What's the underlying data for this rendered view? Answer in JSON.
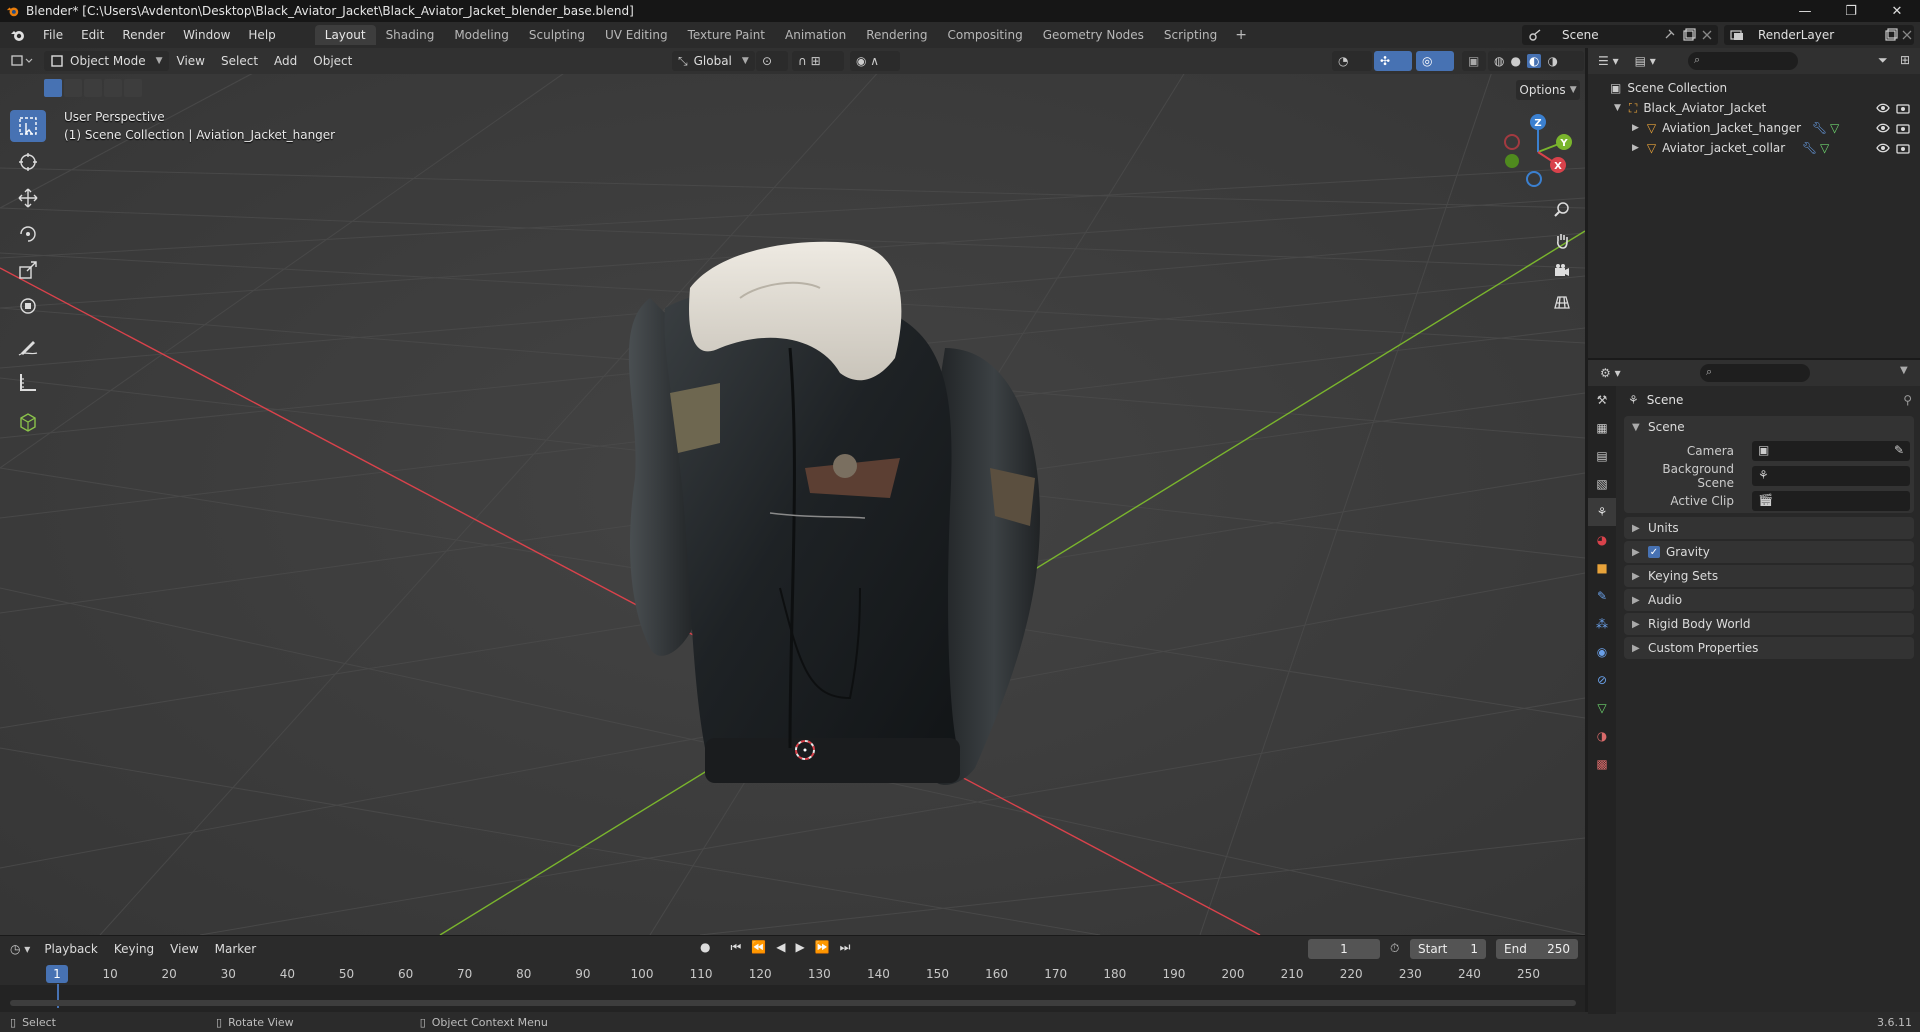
{
  "window": {
    "title": "Blender* [C:\\Users\\Avdenton\\Desktop\\Black_Aviator_Jacket\\Black_Aviator_Jacket_blender_base.blend]",
    "minimize": "—",
    "maximize": "❐",
    "close": "✕"
  },
  "menubar": {
    "items": [
      "File",
      "Edit",
      "Render",
      "Window",
      "Help"
    ],
    "workspaces": [
      "Layout",
      "Shading",
      "Modeling",
      "Sculpting",
      "UV Editing",
      "Texture Paint",
      "Animation",
      "Rendering",
      "Compositing",
      "Geometry Nodes",
      "Scripting"
    ],
    "active_workspace": "Layout",
    "add_tab": "+",
    "scene": "Scene",
    "render_layer": "RenderLayer"
  },
  "viewport": {
    "mode": "Object Mode",
    "menus": [
      "View",
      "Select",
      "Add",
      "Object"
    ],
    "orientation": "Global",
    "options": "Options",
    "perspective": "User Perspective",
    "context": "(1) Scene Collection | Aviation_Jacket_hanger",
    "gizmo_x": "X",
    "gizmo_y": "Y",
    "gizmo_z": "Z"
  },
  "outliner": {
    "root": "Scene Collection",
    "collection": "Black_Aviator_Jacket",
    "objects": [
      "Aviation_Jacket_hanger",
      "Aviator_jacket_collar"
    ]
  },
  "properties": {
    "title": "Scene",
    "panel_scene": "Scene",
    "fields": {
      "camera": "Camera",
      "background_scene": "Background Scene",
      "active_clip": "Active Clip"
    },
    "collapsed_panels": [
      "Units",
      "Gravity",
      "Keying Sets",
      "Audio",
      "Rigid Body World",
      "Custom Properties"
    ],
    "gravity_checked": "✓"
  },
  "timeline": {
    "menus": [
      "Playback",
      "Keying",
      "View",
      "Marker"
    ],
    "current_frame": "1",
    "start_label": "Start",
    "start": "1",
    "end_label": "End",
    "end": "250",
    "ruler": [
      "10",
      "20",
      "30",
      "40",
      "50",
      "60",
      "70",
      "80",
      "90",
      "100",
      "110",
      "120",
      "130",
      "140",
      "150",
      "160",
      "170",
      "180",
      "190",
      "200",
      "210",
      "220",
      "230",
      "240",
      "250"
    ],
    "cursor": "1"
  },
  "statusbar": {
    "select": "Select",
    "rotate": "Rotate View",
    "context_menu": "Object Context Menu",
    "version": "3.6.11"
  },
  "colors": {
    "accent": "#4772b3",
    "x_axis": "#d9424b",
    "y_axis": "#7ab52d",
    "z_axis": "#3b80d0"
  }
}
